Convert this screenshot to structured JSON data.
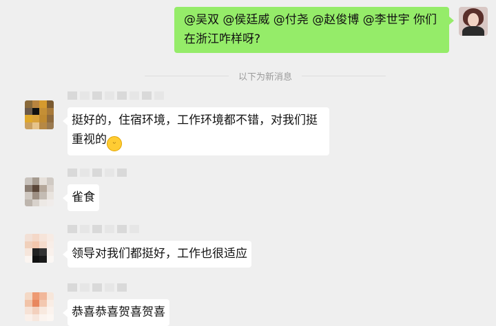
{
  "chat": {
    "outgoing": {
      "text": "@吴双 @侯廷威 @付尧 @赵俊博 @李世宇 你们在浙江咋样呀?"
    },
    "divider": "以下为新消息",
    "messages": [
      {
        "text": "挺好的，住宿环境，工作环境都不错，对我们挺重视的",
        "emoji": "grinning-face-emoji"
      },
      {
        "text": "雀食"
      },
      {
        "text": "领导对我们都挺好，工作也很适应"
      },
      {
        "text": "恭喜恭喜贺喜贺喜"
      }
    ]
  }
}
